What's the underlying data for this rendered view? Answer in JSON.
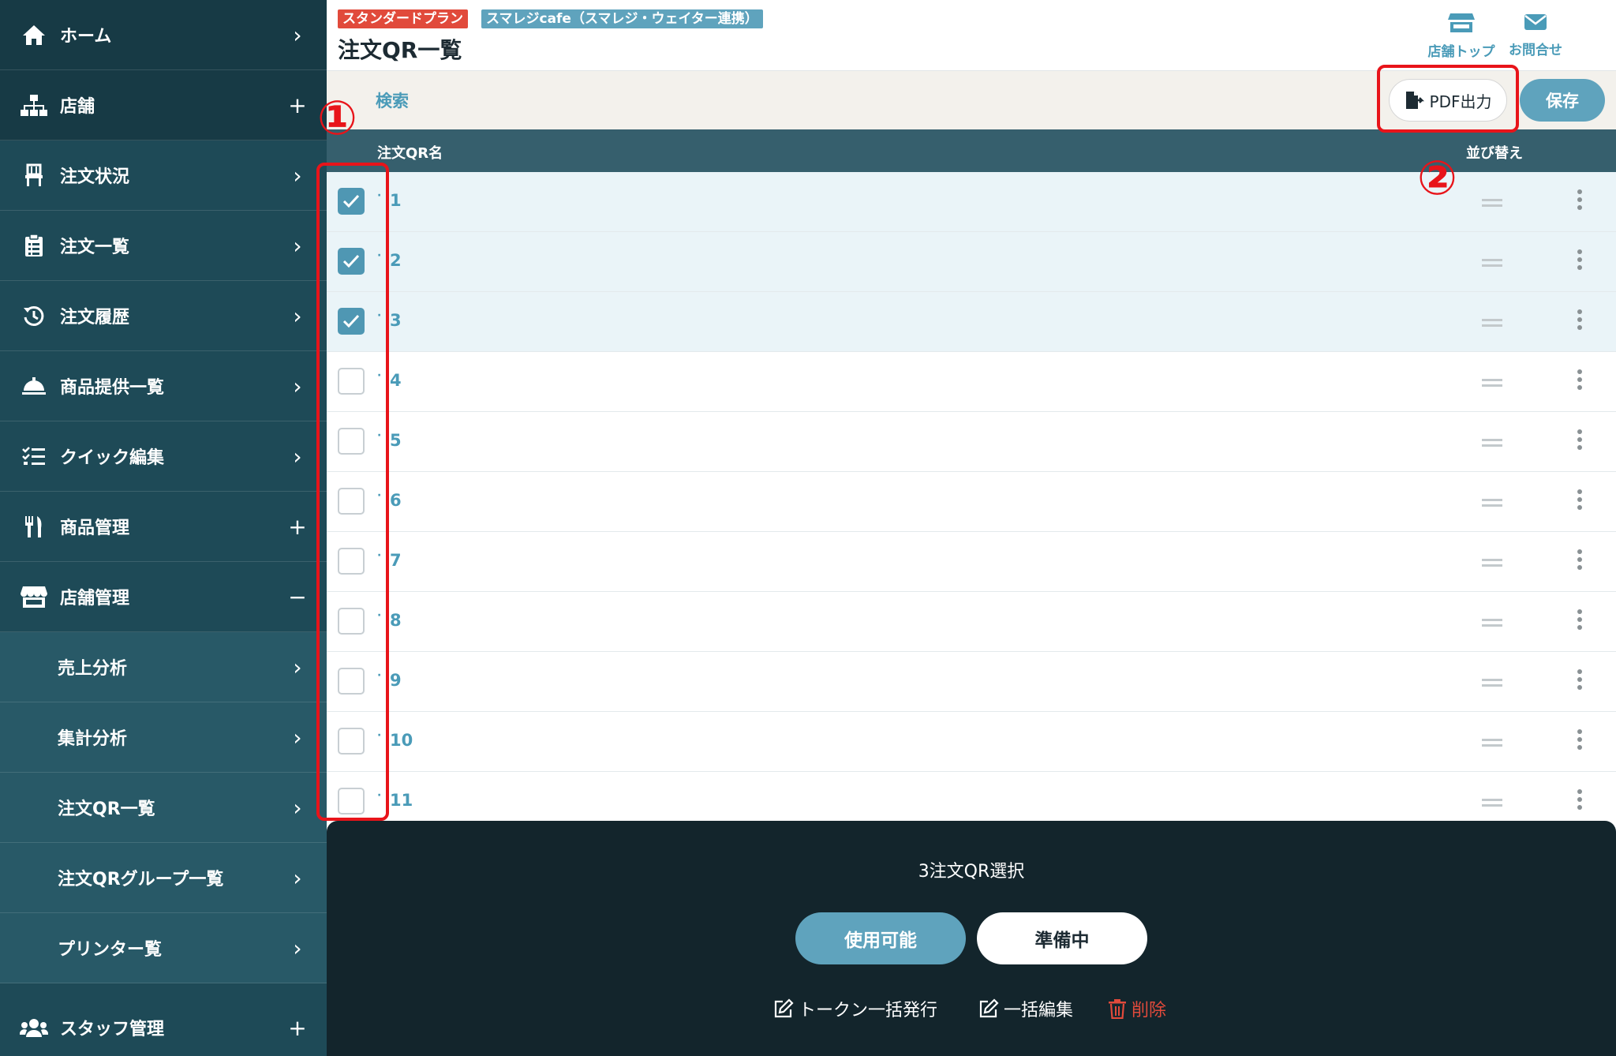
{
  "sidebar": {
    "items": [
      {
        "label": "ホーム",
        "icon": "home-icon",
        "trail": "›"
      },
      {
        "label": "店舗",
        "icon": "sitemap-icon",
        "trail": "+"
      },
      {
        "label": "注文状況",
        "icon": "chair-icon",
        "trail": "›"
      },
      {
        "label": "注文一覧",
        "icon": "clipboard-list-icon",
        "trail": "›"
      },
      {
        "label": "注文履歴",
        "icon": "history-icon",
        "trail": "›"
      },
      {
        "label": "商品提供一覧",
        "icon": "service-bell-icon",
        "trail": "›"
      },
      {
        "label": "クイック編集",
        "icon": "list-check-icon",
        "trail": "›"
      },
      {
        "label": "商品管理",
        "icon": "utensils-icon",
        "trail": "+"
      },
      {
        "label": "店舗管理",
        "icon": "store-icon",
        "trail": "−"
      },
      {
        "label": "売上分析",
        "icon": "",
        "trail": "›"
      },
      {
        "label": "集計分析",
        "icon": "",
        "trail": "›"
      },
      {
        "label": "注文QR一覧",
        "icon": "",
        "trail": "›"
      },
      {
        "label": "注文QRグループ一覧",
        "icon": "",
        "trail": "›"
      },
      {
        "label": "プリンター覧",
        "icon": "",
        "trail": "›"
      },
      {
        "label": "スタッフ管理",
        "icon": "users-icon",
        "trail": "+"
      }
    ]
  },
  "header": {
    "plan_badge": "スタンダードプラン",
    "store_badge": "スマレジcafe（スマレジ・ウェイター連携）",
    "title": "注文QR一覧",
    "store_top_label": "店舗トップ",
    "contact_label": "お問合せ"
  },
  "toolbar": {
    "search_label": "検索",
    "pdf_label": "PDF出力",
    "save_label": "保存"
  },
  "table": {
    "col_name": "注文QR名",
    "col_sort": "並び替え",
    "rows": [
      {
        "name": "1",
        "checked": true
      },
      {
        "name": "2",
        "checked": true
      },
      {
        "name": "3",
        "checked": true
      },
      {
        "name": "4",
        "checked": false
      },
      {
        "name": "5",
        "checked": false
      },
      {
        "name": "6",
        "checked": false
      },
      {
        "name": "7",
        "checked": false
      },
      {
        "name": "8",
        "checked": false
      },
      {
        "name": "9",
        "checked": false
      },
      {
        "name": "10",
        "checked": false
      },
      {
        "name": "11",
        "checked": false
      }
    ]
  },
  "bottom": {
    "selection_text": "3注文QR選択",
    "available_label": "使用可能",
    "preparing_label": "準備中",
    "token_issue_label": "トークン一括発行",
    "bulk_edit_label": "一括編集",
    "delete_label": "削除"
  },
  "annotations": {
    "marker_1": "①",
    "marker_2": "②"
  },
  "colors": {
    "accent": "#5fa3bd",
    "sidebar": "#1e4a57",
    "danger": "#e14a3b",
    "annotation": "#e8141a"
  }
}
